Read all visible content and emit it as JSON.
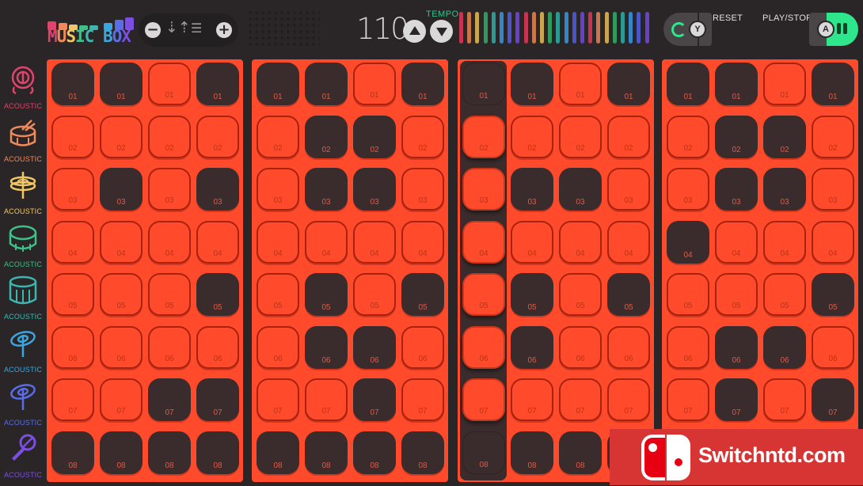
{
  "app": {
    "title_words": [
      "MUSIC",
      "BOX"
    ],
    "logo_letters": [
      {
        "ch": "M",
        "color": "#e0436b"
      },
      {
        "ch": "U",
        "color": "#ef8a5c"
      },
      {
        "ch": "S",
        "color": "#f1c764"
      },
      {
        "ch": "I",
        "color": "#3fbf8a"
      },
      {
        "ch": "C",
        "color": "#3bb7b0"
      },
      {
        "ch": " ",
        "color": "#000000"
      },
      {
        "ch": "B",
        "color": "#3aa6e0"
      },
      {
        "ch": "O",
        "color": "#5a6de6"
      },
      {
        "ch": "X",
        "color": "#7b4fe0"
      }
    ],
    "logo_block_colors": [
      "#e0436b",
      "#ef8a5c",
      "#f1c764",
      "#3fbf8a",
      "#3bb7b0",
      "#3aa6e0",
      "#5a6de6",
      "#7b4fe0"
    ]
  },
  "header": {
    "octave_minus_icon": "minus-circle-icon",
    "sort_icon": "sort-arrows-icon",
    "mixer_icon": "sliders-icon",
    "octave_plus_icon": "plus-circle-icon",
    "tempo": {
      "label": "TEMPO",
      "value": "110",
      "up_icon": "triangle-up-icon",
      "down_icon": "triangle-down-icon",
      "bar_colors": [
        "#c6344f",
        "#c9774a",
        "#c9a54f",
        "#2f9a5c",
        "#2b9a93",
        "#3586c9",
        "#4a55c9",
        "#6a3fc9"
      ],
      "bar_count": 24
    },
    "reset": {
      "label": "RESET",
      "key": "Y",
      "icon": "reset-icon",
      "accent": "#2ee68c"
    },
    "play_stop": {
      "label": "PLAY/STOP",
      "key": "A",
      "icon": "pause-icon",
      "accent": "#2ee68c",
      "playing": true
    }
  },
  "instruments": [
    {
      "label": "ACOUSTIC",
      "icon": "gong-icon",
      "color": "#e0436b"
    },
    {
      "label": "ACOUSTIC",
      "icon": "snare-drum-icon",
      "color": "#ef8a5c"
    },
    {
      "label": "ACOUSTIC",
      "icon": "hihat-icon",
      "color": "#f1c764"
    },
    {
      "label": "ACOUSTIC",
      "icon": "tom-drum-icon",
      "color": "#3fbf8a"
    },
    {
      "label": "ACOUSTIC",
      "icon": "floor-tom-icon",
      "color": "#3bb7b0"
    },
    {
      "label": "ACOUSTIC",
      "icon": "ride-cymbal-icon",
      "color": "#3aa6e0"
    },
    {
      "label": "ACOUSTIC",
      "icon": "crash-cymbal-icon",
      "color": "#5a6de6"
    },
    {
      "label": "ACOUSTIC",
      "icon": "microphone-icon",
      "color": "#7b4fe0"
    }
  ],
  "sequencer": {
    "row_labels": [
      "01",
      "02",
      "03",
      "04",
      "05",
      "06",
      "07",
      "08"
    ],
    "active_color": "#3a2b2c",
    "panel_color": "#ff4b2b",
    "playhead": {
      "panel": 3,
      "step": 1
    },
    "panels": [
      {
        "grid": [
          [
            1,
            1,
            0,
            1
          ],
          [
            0,
            0,
            0,
            0
          ],
          [
            0,
            1,
            0,
            1
          ],
          [
            0,
            0,
            0,
            0
          ],
          [
            0,
            0,
            0,
            1
          ],
          [
            0,
            0,
            0,
            0
          ],
          [
            0,
            0,
            1,
            1
          ],
          [
            1,
            1,
            1,
            1
          ]
        ]
      },
      {
        "grid": [
          [
            1,
            1,
            0,
            1
          ],
          [
            0,
            1,
            1,
            0
          ],
          [
            0,
            1,
            1,
            0
          ],
          [
            0,
            0,
            0,
            0
          ],
          [
            0,
            1,
            0,
            1
          ],
          [
            0,
            1,
            1,
            0
          ],
          [
            0,
            0,
            1,
            0
          ],
          [
            1,
            1,
            1,
            1
          ]
        ]
      },
      {
        "grid": [
          [
            1,
            1,
            0,
            1
          ],
          [
            0,
            0,
            0,
            0
          ],
          [
            0,
            1,
            1,
            0
          ],
          [
            0,
            0,
            0,
            0
          ],
          [
            0,
            1,
            0,
            1
          ],
          [
            0,
            1,
            0,
            0
          ],
          [
            0,
            0,
            0,
            0
          ],
          [
            1,
            1,
            1,
            1
          ]
        ]
      },
      {
        "grid": [
          [
            1,
            1,
            0,
            1
          ],
          [
            0,
            1,
            1,
            0
          ],
          [
            0,
            1,
            1,
            0
          ],
          [
            1,
            0,
            0,
            0
          ],
          [
            0,
            0,
            0,
            1
          ],
          [
            0,
            1,
            1,
            0
          ],
          [
            0,
            1,
            0,
            1
          ],
          [
            1,
            1,
            1,
            1
          ]
        ]
      }
    ]
  },
  "watermark": {
    "text": "Switchntd.com"
  }
}
